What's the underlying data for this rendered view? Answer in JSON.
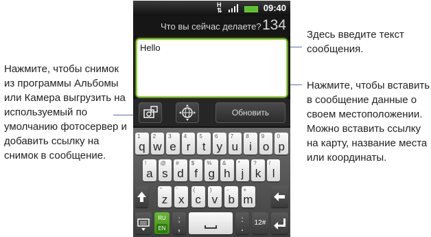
{
  "status": {
    "time": "09:40"
  },
  "header": {
    "question": "Что вы сейчас делаете?",
    "counter": "134"
  },
  "textbox": {
    "value": "Hello"
  },
  "actions": {
    "update_label": "Обновить"
  },
  "keyboard": {
    "row1": [
      {
        "num": "1",
        "ch": "q"
      },
      {
        "num": "2",
        "ch": "w"
      },
      {
        "num": "3",
        "ch": "e"
      },
      {
        "num": "4",
        "ch": "r"
      },
      {
        "num": "5",
        "ch": "t"
      },
      {
        "num": "6",
        "ch": "y"
      },
      {
        "num": "7",
        "ch": "u"
      },
      {
        "num": "8",
        "ch": "i"
      },
      {
        "num": "9",
        "ch": "o"
      },
      {
        "num": "0",
        "ch": "p"
      }
    ],
    "row2": [
      {
        "num": "!",
        "ch": "a"
      },
      {
        "num": "@",
        "ch": "s"
      },
      {
        "num": "#",
        "ch": "d"
      },
      {
        "num": "$",
        "ch": "f"
      },
      {
        "num": "%",
        "ch": "g"
      },
      {
        "num": "&",
        "ch": "h"
      },
      {
        "num": "*",
        "ch": "j"
      },
      {
        "num": "?",
        "ch": "k"
      },
      {
        "num": "/",
        "ch": "l"
      }
    ],
    "row3": [
      {
        "num": "\"",
        "ch": "z"
      },
      {
        "num": "'",
        "ch": "x"
      },
      {
        "num": "(",
        "ch": "c"
      },
      {
        "num": ")",
        "ch": "v"
      },
      {
        "num": "-",
        "ch": "b"
      },
      {
        "num": "+",
        "ch": "m"
      }
    ],
    "lang_top": "RU",
    "lang_bottom": "EN",
    "semicolon": ";",
    "comma": ",",
    "colon": ":",
    "period": ".",
    "symbols": "12#"
  },
  "callouts": {
    "left": "Нажмите, чтобы снимок из программы Альбомы или Камера выгрузить на используемый по умолчанию фотосервер и добавить ссылку на снимок в сообщение.",
    "right_top": "Здесь введите текст сообщения.",
    "right_bottom": "Нажмите, чтобы вставить в сообщение данные о своем местоположении. Можно вставить ссылку на карту, название места или координаты."
  }
}
